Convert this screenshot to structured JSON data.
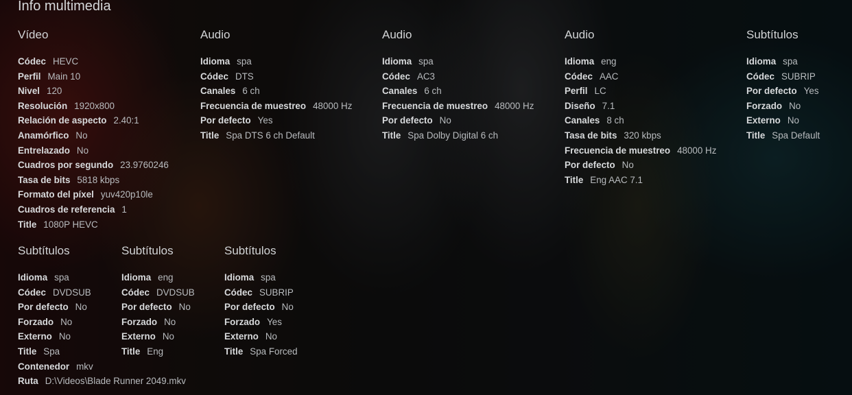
{
  "page_title": "Info multimedia",
  "video": {
    "title": "Vídeo",
    "rows": [
      {
        "key": "Códec",
        "value": "HEVC"
      },
      {
        "key": "Perfil",
        "value": "Main 10"
      },
      {
        "key": "Nivel",
        "value": "120"
      },
      {
        "key": "Resolución",
        "value": "1920x800"
      },
      {
        "key": "Relación de aspecto",
        "value": "2.40:1"
      },
      {
        "key": "Anamórfico",
        "value": "No"
      },
      {
        "key": "Entrelazado",
        "value": "No"
      },
      {
        "key": "Cuadros por segundo",
        "value": "23.9760246"
      },
      {
        "key": "Tasa de bits",
        "value": "5818 kbps"
      },
      {
        "key": "Formato del píxel",
        "value": "yuv420p10le"
      },
      {
        "key": "Cuadros de referencia",
        "value": "1"
      },
      {
        "key": "Title",
        "value": "1080P HEVC"
      }
    ]
  },
  "audio_1": {
    "title": "Audio",
    "rows": [
      {
        "key": "Idioma",
        "value": "spa"
      },
      {
        "key": "Códec",
        "value": "DTS"
      },
      {
        "key": "Canales",
        "value": "6 ch"
      },
      {
        "key": "Frecuencia de muestreo",
        "value": "48000 Hz"
      },
      {
        "key": "Por defecto",
        "value": "Yes"
      },
      {
        "key": "Title",
        "value": "Spa DTS 6 ch Default"
      }
    ]
  },
  "audio_2": {
    "title": "Audio",
    "rows": [
      {
        "key": "Idioma",
        "value": "spa"
      },
      {
        "key": "Códec",
        "value": "AC3"
      },
      {
        "key": "Canales",
        "value": "6 ch"
      },
      {
        "key": "Frecuencia de muestreo",
        "value": "48000 Hz"
      },
      {
        "key": "Por defecto",
        "value": "No"
      },
      {
        "key": "Title",
        "value": "Spa Dolby Digital 6 ch"
      }
    ]
  },
  "audio_3": {
    "title": "Audio",
    "rows": [
      {
        "key": "Idioma",
        "value": "eng"
      },
      {
        "key": "Códec",
        "value": "AAC"
      },
      {
        "key": "Perfil",
        "value": "LC"
      },
      {
        "key": "Diseño",
        "value": "7.1"
      },
      {
        "key": "Canales",
        "value": "8 ch"
      },
      {
        "key": "Tasa de bits",
        "value": "320 kbps"
      },
      {
        "key": "Frecuencia de muestreo",
        "value": "48000 Hz"
      },
      {
        "key": "Por defecto",
        "value": "No"
      },
      {
        "key": "Title",
        "value": "Eng AAC 7.1"
      }
    ]
  },
  "subs_1": {
    "title": "Subtítulos",
    "rows": [
      {
        "key": "Idioma",
        "value": "spa"
      },
      {
        "key": "Códec",
        "value": "SUBRIP"
      },
      {
        "key": "Por defecto",
        "value": "Yes"
      },
      {
        "key": "Forzado",
        "value": "No"
      },
      {
        "key": "Externo",
        "value": "No"
      },
      {
        "key": "Title",
        "value": "Spa Default"
      }
    ]
  },
  "subs_2": {
    "title": "Subtítulos",
    "rows": [
      {
        "key": "Idioma",
        "value": "spa"
      },
      {
        "key": "Códec",
        "value": "DVDSUB"
      },
      {
        "key": "Por defecto",
        "value": "No"
      },
      {
        "key": "Forzado",
        "value": "No"
      },
      {
        "key": "Externo",
        "value": "No"
      },
      {
        "key": "Title",
        "value": "Spa"
      },
      {
        "key": "Contenedor",
        "value": "mkv"
      },
      {
        "key": "Ruta",
        "value": "D:\\Videos\\Blade Runner 2049.mkv"
      }
    ]
  },
  "subs_3": {
    "title": "Subtítulos",
    "rows": [
      {
        "key": "Idioma",
        "value": "eng"
      },
      {
        "key": "Códec",
        "value": "DVDSUB"
      },
      {
        "key": "Por defecto",
        "value": "No"
      },
      {
        "key": "Forzado",
        "value": "No"
      },
      {
        "key": "Externo",
        "value": "No"
      },
      {
        "key": "Title",
        "value": "Eng"
      }
    ]
  },
  "subs_4": {
    "title": "Subtítulos",
    "rows": [
      {
        "key": "Idioma",
        "value": "spa"
      },
      {
        "key": "Códec",
        "value": "SUBRIP"
      },
      {
        "key": "Por defecto",
        "value": "No"
      },
      {
        "key": "Forzado",
        "value": "Yes"
      },
      {
        "key": "Externo",
        "value": "No"
      },
      {
        "key": "Title",
        "value": "Spa Forced"
      }
    ]
  }
}
